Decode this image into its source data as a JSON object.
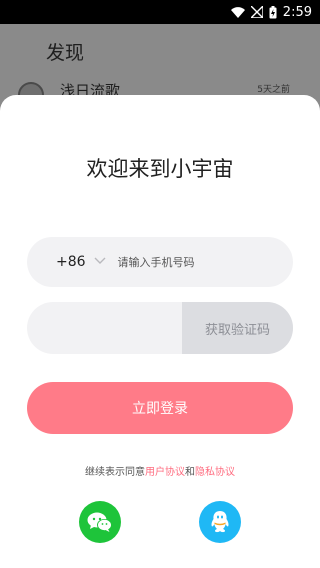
{
  "status_bar": {
    "time": "2:59"
  },
  "background_page": {
    "title": "发现",
    "post_user": "浅日流歌",
    "post_time": "5天之前"
  },
  "login_sheet": {
    "welcome": "欢迎来到小宇宙",
    "country_code": "+86",
    "phone_placeholder": "请输入手机号码",
    "code_placeholder": "",
    "get_code_label": "获取验证码",
    "login_label": "立即登录",
    "terms": {
      "prefix": "继续表示同意",
      "user_agreement": "用户协议",
      "and": "和",
      "privacy_policy": "隐私协议"
    },
    "social": [
      "wechat-icon",
      "qq-icon"
    ]
  },
  "colors": {
    "login_button": "#ff7b88",
    "link": "#ff6d80",
    "wechat": "#1ec43a",
    "qq": "#1fb8f5"
  }
}
